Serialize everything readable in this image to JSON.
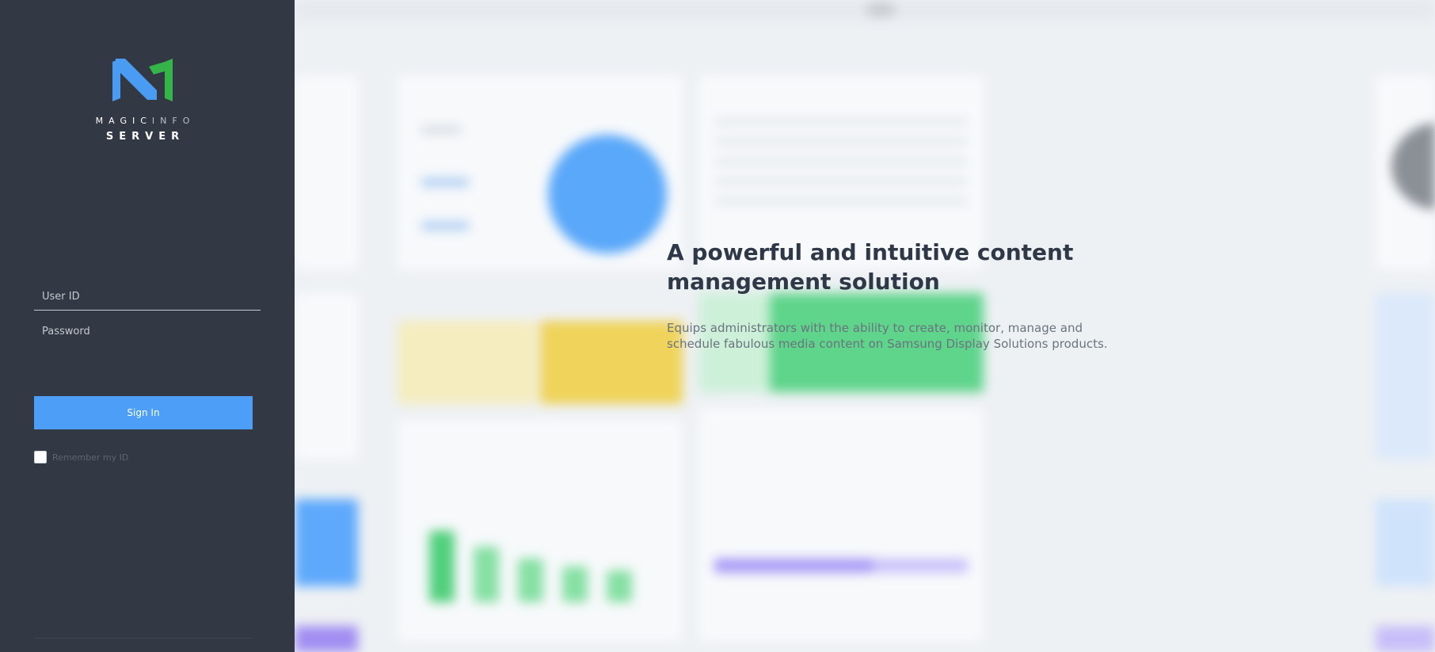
{
  "brand": {
    "line1_bold": "MAGIC",
    "line1_light": "INFO",
    "line2": "SERVER",
    "colors": {
      "logo_blue": "#4a9cf3",
      "logo_green": "#35b44a"
    }
  },
  "login": {
    "user_id_placeholder": "User ID",
    "password_placeholder": "Password",
    "sign_in_label": "Sign In",
    "remember_label": "Remember my ID",
    "remember_checked": false
  },
  "hero": {
    "title": "A powerful and intuitive content management solution",
    "description": "Equips administrators with the ability to create, monitor, manage and schedule fabulous media content on Samsung Display Solutions products."
  },
  "colors": {
    "sidebar_bg": "#323944",
    "accent": "#4c9ef6",
    "page_bg": "#eef1f4"
  }
}
